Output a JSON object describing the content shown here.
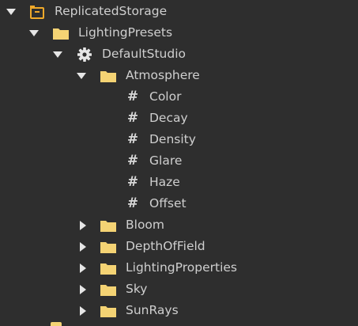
{
  "explorer": {
    "root": {
      "label": "ReplicatedStorage",
      "icon": "replicated-storage-icon",
      "expanded": true
    },
    "lighting_presets": {
      "label": "LightingPresets",
      "icon": "folder-icon",
      "expanded": true
    },
    "default_studio": {
      "label": "DefaultStudio",
      "icon": "gear-icon",
      "expanded": true
    },
    "atmosphere": {
      "label": "Atmosphere",
      "icon": "folder-icon",
      "expanded": true,
      "values": [
        {
          "label": "Color",
          "icon": "number-value-icon"
        },
        {
          "label": "Decay",
          "icon": "number-value-icon"
        },
        {
          "label": "Density",
          "icon": "number-value-icon"
        },
        {
          "label": "Glare",
          "icon": "number-value-icon"
        },
        {
          "label": "Haze",
          "icon": "number-value-icon"
        },
        {
          "label": "Offset",
          "icon": "number-value-icon"
        }
      ]
    },
    "collapsed_folders": [
      {
        "label": "Bloom",
        "icon": "folder-icon"
      },
      {
        "label": "DepthOfField",
        "icon": "folder-icon"
      },
      {
        "label": "LightingProperties",
        "icon": "folder-icon"
      },
      {
        "label": "Sky",
        "icon": "folder-icon"
      },
      {
        "label": "SunRays",
        "icon": "folder-icon"
      }
    ],
    "hash_glyph": "#"
  },
  "colors": {
    "background": "#2e2e2e",
    "text": "#cfcfcf",
    "folder": "#f4d374",
    "storage_icon": "#f0a92a",
    "arrow": "#e6e6e6"
  }
}
